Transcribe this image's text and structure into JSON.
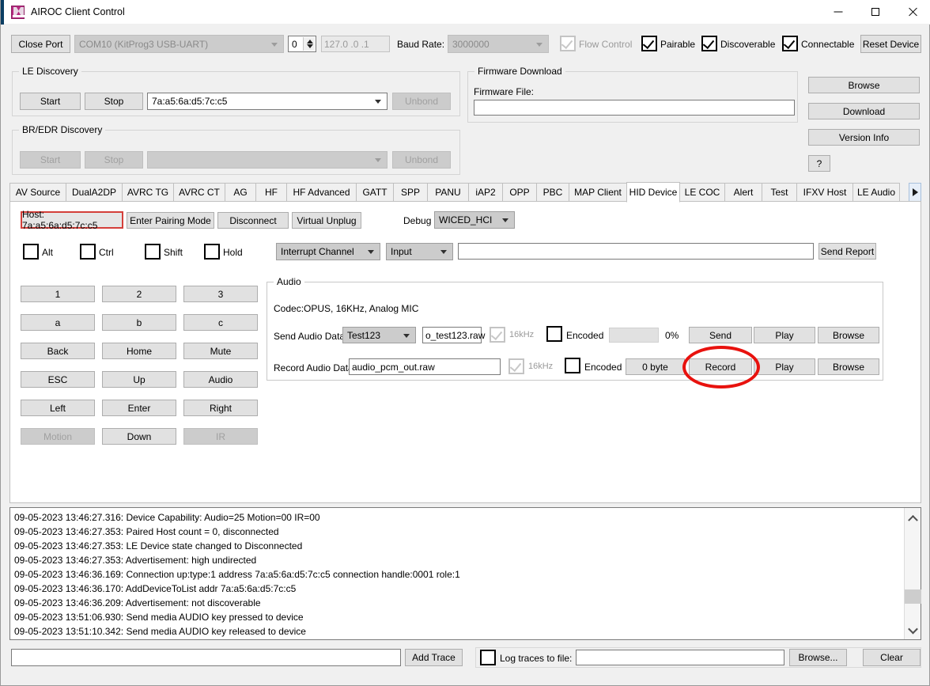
{
  "window": {
    "title": "AIROC Client Control",
    "icon": "app-icon",
    "minimize": "minimize-icon",
    "maximize": "maximize-icon",
    "close": "close-icon"
  },
  "toolbar": {
    "close_port_label": "Close Port",
    "port_value": "COM10 (KitProg3 USB-UART)",
    "spin_value": "0",
    "ip_value": "127.0 .0 .1",
    "baud_label": "Baud Rate:",
    "baud_value": "3000000",
    "flow_control_label": "Flow Control",
    "flow_control_checked": true,
    "flow_control_enabled": false,
    "pairable_label": "Pairable",
    "pairable_checked": true,
    "discoverable_label": "Discoverable",
    "discoverable_checked": true,
    "connectable_label": "Connectable",
    "connectable_checked": true,
    "reset_device_label": "Reset Device"
  },
  "le_discovery": {
    "caption": "LE Discovery",
    "start_label": "Start",
    "stop_label": "Stop",
    "device_value": "7a:a5:6a:d5:7c:c5",
    "unbond_label": "Unbond"
  },
  "bredr_discovery": {
    "caption": "BR/EDR Discovery",
    "start_label": "Start",
    "stop_label": "Stop",
    "device_value": "",
    "unbond_label": "Unbond"
  },
  "firmware": {
    "caption": "Firmware Download",
    "file_label": "Firmware File:",
    "file_value": "",
    "browse_label": "Browse",
    "download_label": "Download",
    "version_info_label": "Version Info",
    "help_label": "?"
  },
  "tabs": {
    "items": [
      {
        "label": "AV Source",
        "active": false
      },
      {
        "label": "DualA2DP",
        "active": false
      },
      {
        "label": "AVRC TG",
        "active": false
      },
      {
        "label": "AVRC CT",
        "active": false
      },
      {
        "label": "AG",
        "active": false
      },
      {
        "label": "HF",
        "active": false
      },
      {
        "label": "HF Advanced",
        "active": false
      },
      {
        "label": "GATT",
        "active": false
      },
      {
        "label": "SPP",
        "active": false
      },
      {
        "label": "PANU",
        "active": false
      },
      {
        "label": "iAP2",
        "active": false
      },
      {
        "label": "OPP",
        "active": false
      },
      {
        "label": "PBC",
        "active": false
      },
      {
        "label": "MAP Client",
        "active": false
      },
      {
        "label": "HID Device",
        "active": true
      },
      {
        "label": "LE COC",
        "active": false
      },
      {
        "label": "Alert",
        "active": false
      },
      {
        "label": "Test",
        "active": false
      },
      {
        "label": "IFXV Host",
        "active": false
      },
      {
        "label": "LE Audio",
        "active": false
      }
    ],
    "scroll_right_icon": "chevron-right-icon"
  },
  "hid": {
    "host_label": "Host: 7a:a5:6a:d5:7c:c5",
    "enter_pairing_label": "Enter Pairing Mode",
    "disconnect_label": "Disconnect",
    "virtual_unplug_label": "Virtual Unplug",
    "debug_label": "Debug",
    "debug_value": "WICED_HCI",
    "modifiers": [
      {
        "label": "Alt",
        "checked": false
      },
      {
        "label": "Ctrl",
        "checked": false
      },
      {
        "label": "Shift",
        "checked": false
      },
      {
        "label": "Hold",
        "checked": false
      }
    ],
    "channel_value": "Interrupt Channel",
    "direction_value": "Input",
    "report_value": "",
    "send_report_label": "Send Report",
    "keys": [
      {
        "label": "1",
        "enabled": true
      },
      {
        "label": "2",
        "enabled": true
      },
      {
        "label": "3",
        "enabled": true
      },
      {
        "label": "a",
        "enabled": true
      },
      {
        "label": "b",
        "enabled": true
      },
      {
        "label": "c",
        "enabled": true
      },
      {
        "label": "Back",
        "enabled": true
      },
      {
        "label": "Home",
        "enabled": true
      },
      {
        "label": "Mute",
        "enabled": true
      },
      {
        "label": "ESC",
        "enabled": true
      },
      {
        "label": "Up",
        "enabled": true
      },
      {
        "label": "Audio",
        "enabled": true
      },
      {
        "label": "Left",
        "enabled": true
      },
      {
        "label": "Enter",
        "enabled": true
      },
      {
        "label": "Right",
        "enabled": true
      },
      {
        "label": "Motion",
        "enabled": false
      },
      {
        "label": "Down",
        "enabled": true
      },
      {
        "label": "IR",
        "enabled": false
      }
    ]
  },
  "audio": {
    "caption": "Audio",
    "codec_text": "Codec:OPUS, 16KHz, Analog MIC",
    "send_label": "Send Audio Data:",
    "send_source_value": "Test123",
    "send_file_value": "o_test123.raw",
    "send_rate_label": "16kHz",
    "send_rate_checked": true,
    "send_encoded_label": "Encoded",
    "send_encoded_checked": false,
    "send_progress_value": "",
    "send_percent": "0%",
    "send_button_label": "Send",
    "send_play_label": "Play",
    "send_browse_label": "Browse",
    "record_label": "Record Audio Data:",
    "record_file_value": "audio_pcm_out.raw",
    "record_rate_label": "16kHz",
    "record_rate_checked": true,
    "record_encoded_label": "Encoded",
    "record_encoded_checked": false,
    "record_size_label": "0 byte",
    "record_button_label": "Record",
    "record_play_label": "Play",
    "record_browse_label": "Browse"
  },
  "log": {
    "lines": [
      "09-05-2023 13:46:27.316: Device Capability: Audio=25 Motion=00 IR=00",
      "09-05-2023 13:46:27.353: Paired Host count = 0, disconnected",
      "09-05-2023 13:46:27.353: LE Device state changed to Disconnected",
      "09-05-2023 13:46:27.353: Advertisement: high undirected",
      "09-05-2023 13:46:36.169: Connection up:type:1 address 7a:a5:6a:d5:7c:c5 connection handle:0001 role:1",
      "09-05-2023 13:46:36.170: AddDeviceToList addr 7a:a5:6a:d5:7c:c5",
      "09-05-2023 13:46:36.209: Advertisement: not discoverable",
      "09-05-2023 13:51:06.930: Send media AUDIO key pressed to device",
      "09-05-2023 13:51:10.342: Send media AUDIO key released to device"
    ],
    "scroll_up_icon": "chevron-up-icon",
    "scroll_down_icon": "chevron-down-icon"
  },
  "bottom": {
    "trace_value": "",
    "add_trace_label": "Add Trace",
    "log_to_file_label": "Log traces to file:",
    "log_to_file_checked": false,
    "log_file_value": "",
    "browse_label": "Browse...",
    "clear_label": "Clear"
  },
  "annotation": {
    "color": "#e8120e",
    "target": "record-button"
  }
}
